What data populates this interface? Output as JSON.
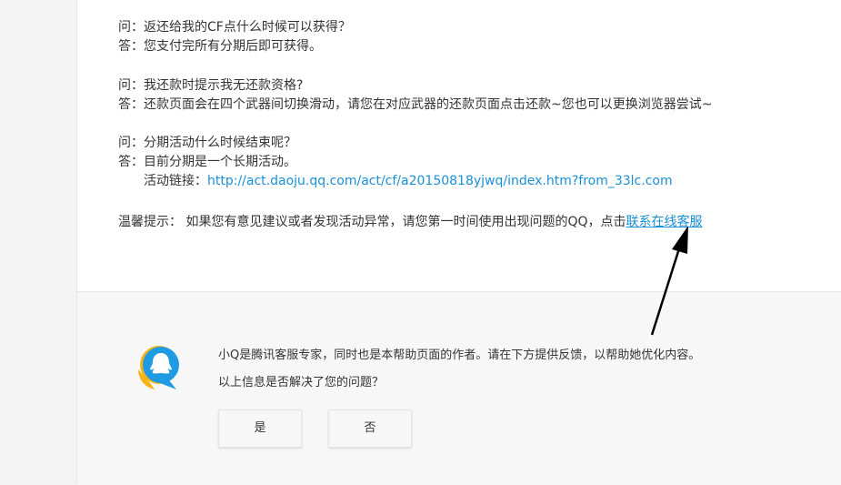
{
  "faq": [
    {
      "q_prefix": "问：",
      "q": "返还给我的CF点什么时候可以获得？",
      "a_prefix": "答：",
      "a": "您支付完所有分期后即可获得。"
    },
    {
      "q_prefix": "问：",
      "q": "我还款时提示我无还款资格?",
      "a_prefix": "答：",
      "a": "还款页面会在四个武器间切换滑动，请您在对应武器的还款页面点击还款~您也可以更换浏览器尝试~"
    },
    {
      "q_prefix": "问：",
      "q": "分期活动什么时候结束呢？",
      "a_prefix": "答：",
      "a": "目前分期是一个长期活动。"
    }
  ],
  "activity_link": {
    "label": "活动链接：",
    "url": "http://act.daoju.qq.com/act/cf/a20150818yjwq/index.htm?from_33lc.com"
  },
  "tip": {
    "label": "温馨提示：",
    "text": " 如果您有意见建议或者发现活动异常，请您第一时间使用出现问题的QQ，点击",
    "link_text": "联系在线客服"
  },
  "feedback": {
    "intro": "小Q是腾讯客服专家，同时也是本帮助页面的作者。请在下方提供反馈，以帮助她优化内容。",
    "question": "以上信息是否解决了您的问题？",
    "yes_label": "是",
    "no_label": "否"
  },
  "colors": {
    "link": "#1a8fd6",
    "text": "#333333",
    "avatar_blue": "#1e9be2",
    "avatar_yellow": "#f5b316"
  }
}
